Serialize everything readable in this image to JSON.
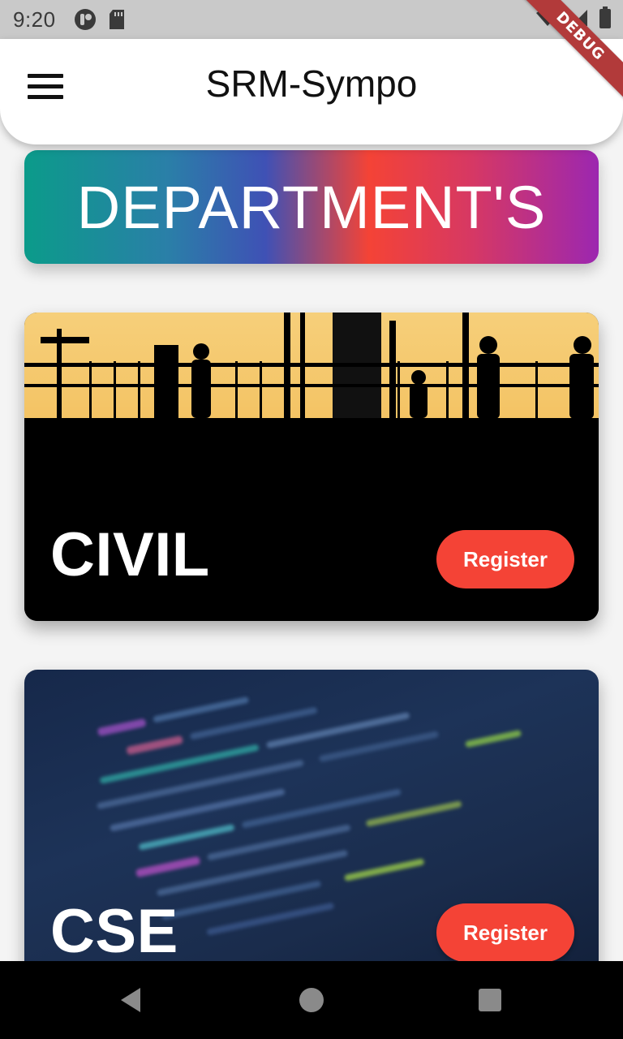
{
  "status_bar": {
    "time": "9:20",
    "icons": [
      "notification-app-icon",
      "sd-card-icon",
      "wifi-icon",
      "signal-icon",
      "battery-icon"
    ]
  },
  "debug_banner": "DEBUG",
  "app_bar": {
    "title": "SRM-Sympo",
    "menu_icon": "hamburger-menu-icon"
  },
  "banner": {
    "text": "DEPARTMENT'S"
  },
  "departments": [
    {
      "name": "CIVIL",
      "register_label": "Register"
    },
    {
      "name": "CSE",
      "register_label": "Register"
    }
  ],
  "nav_bar": {
    "icons": [
      "back-icon",
      "home-icon",
      "recents-icon"
    ]
  },
  "colors": {
    "accent": "#f44336",
    "status_bar": "#c9c9c9",
    "nav_bar": "#000000",
    "banner_gradient": [
      "#0b9b8a",
      "#3f51b5",
      "#f44336",
      "#9c27b0"
    ]
  }
}
